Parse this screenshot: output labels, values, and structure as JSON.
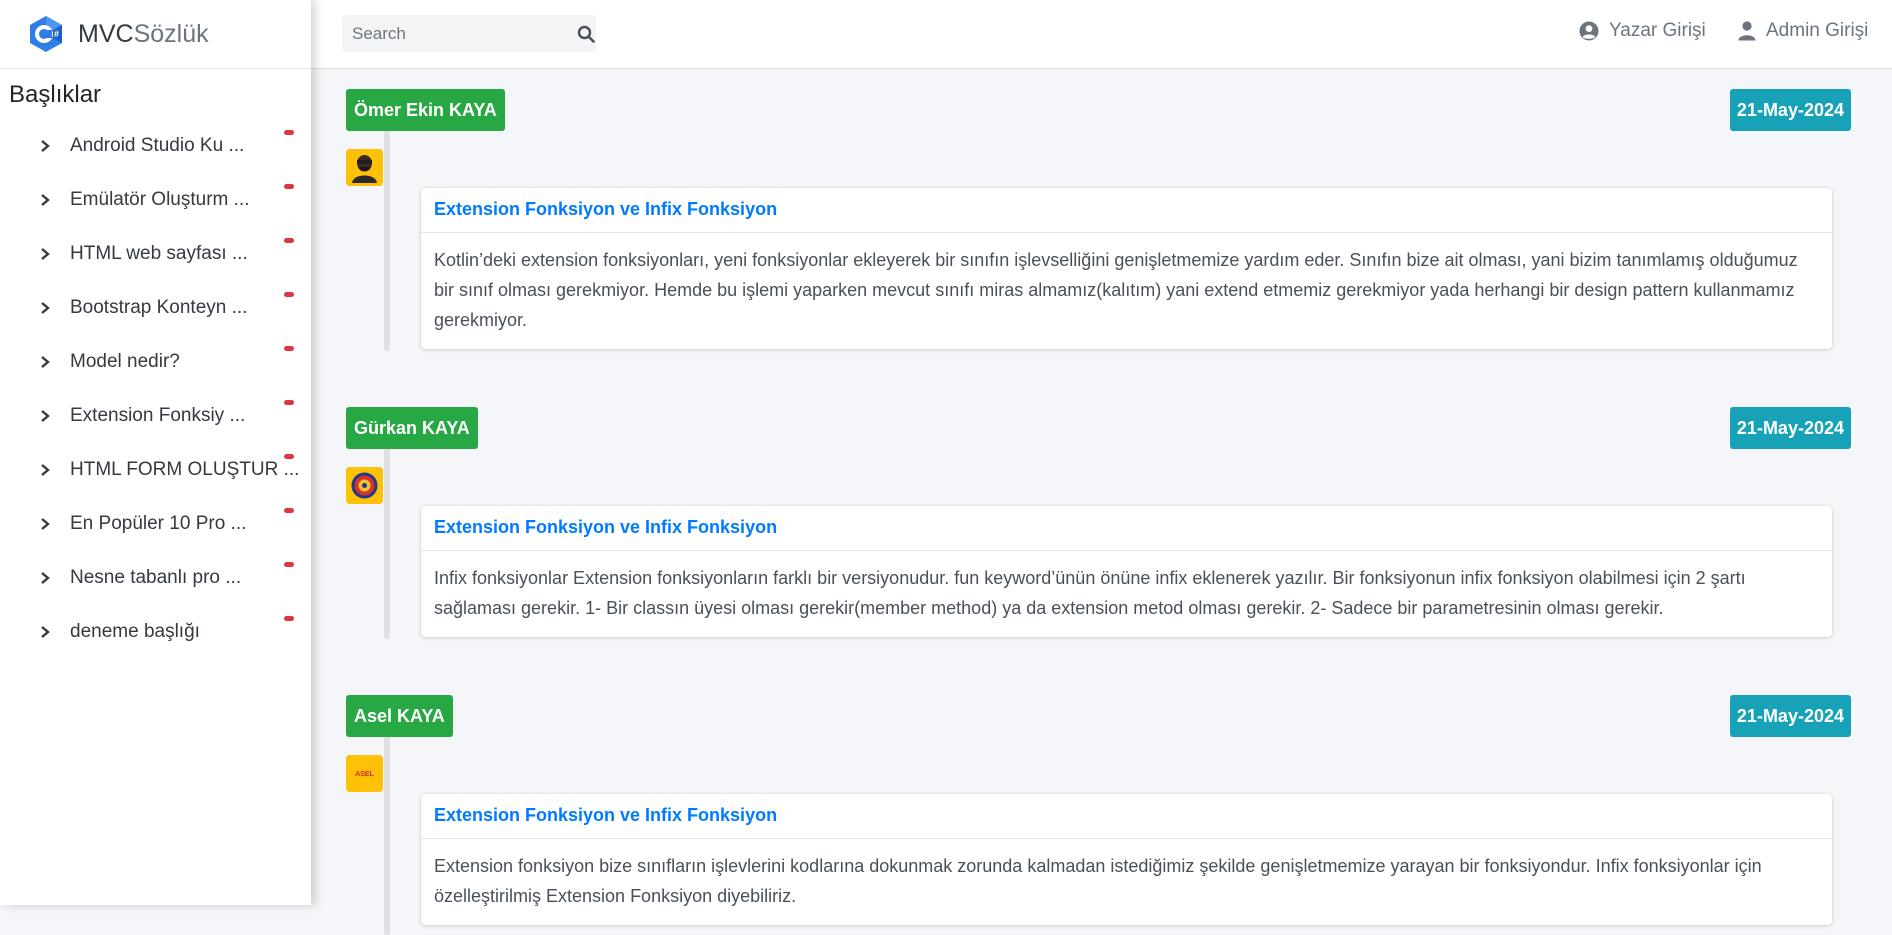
{
  "brand": {
    "prefix": "MVC",
    "suffix": "Sözlük"
  },
  "sidebar": {
    "heading": "Başlıklar",
    "items": [
      {
        "label": "Android Studio Ku ..."
      },
      {
        "label": "Emülatör Oluşturm ..."
      },
      {
        "label": "HTML web sayfası ..."
      },
      {
        "label": "Bootstrap Konteyn ..."
      },
      {
        "label": "Model nedir?"
      },
      {
        "label": "Extension Fonksiy ..."
      },
      {
        "label": "HTML FORM OLUŞTUR ..."
      },
      {
        "label": "En Popüler 10 Pro ..."
      },
      {
        "label": "Nesne tabanlı pro ..."
      },
      {
        "label": "deneme başlığı"
      }
    ]
  },
  "topbar": {
    "search_placeholder": "Search",
    "links": {
      "writer": "Yazar Girişi",
      "admin": "Admin Girişi"
    }
  },
  "entries": [
    {
      "author": "Ömer Ekin KAYA",
      "date": "21-May-2024",
      "title": "Extension Fonksiyon ve Infix Fonksiyon",
      "body": "Kotlin’deki extension fonksiyonları, yeni fonksiyonlar ekleyerek bir sınıfın işlevselliğini genişletmemize yardım eder. Sınıfın bize ait olması, yani bizim tanımlamış olduğumuz bir sınıf olması gerekmiyor. Hemde bu işlemi yaparken mevcut sınıfı miras almamız(kalıtım) yani extend etmemiz gerekmiyor yada herhangi bir design pattern kullanmamız gerekmiyor."
    },
    {
      "author": "Gürkan KAYA",
      "date": "21-May-2024",
      "title": "Extension Fonksiyon ve Infix Fonksiyon",
      "body": "Infix fonksiyonlar Extension fonksiyonların farklı bir versiyonudur. fun keyword’ünün önüne infix eklenerek yazılır. Bir fonksiyonun infix fonksiyon olabilmesi için 2 şartı sağlaması gerekir. 1- Bir classın üyesi olması gerekir(member method) ya da extension metod olması gerekir. 2- Sadece bir parametresinin olması gerekir."
    },
    {
      "author": "Asel KAYA",
      "date": "21-May-2024",
      "title": "Extension Fonksiyon ve Infix Fonksiyon",
      "body": "Extension fonksiyon bize sınıfların işlevlerini kodlarına dokunmak zorunda kalmadan istediğimiz şekilde genişletmemize yarayan bir fonksiyondur. Infix fonksiyonlar için özelleştirilmiş Extension Fonksiyon diyebiliriz.",
      "avatar_text": "ASEL"
    }
  ],
  "colors": {
    "author_badge": "#28a745",
    "date_badge": "#17a2b8",
    "title_link": "#007bff",
    "notification_badge": "#dc3545",
    "avatar_bg": "#ffc107"
  }
}
